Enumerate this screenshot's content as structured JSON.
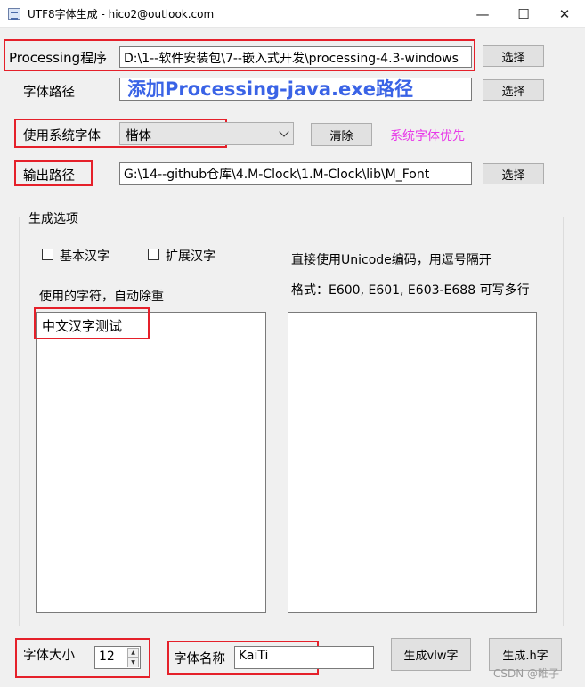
{
  "window": {
    "title": "UTF8字体生成 - hico2@outlook.com",
    "minimize_glyph": "—",
    "maximize_glyph": "☐",
    "close_glyph": "✕"
  },
  "processing": {
    "label": "Processing程序",
    "path_value": "D:\\1--软件安装包\\7--嵌入式开发\\processing-4.3-windows",
    "choose_label": "选择"
  },
  "font_path": {
    "label": "字体路径",
    "value": "",
    "choose_label": "选择"
  },
  "annotation": "添加Processing-java.exe路径",
  "system_font": {
    "label": "使用系统字体",
    "selected": "楷体",
    "clear_label": "清除",
    "priority_note": "系统字体优先"
  },
  "output_path": {
    "label": "输出路径",
    "value": "G:\\14--github仓库\\4.M-Clock\\1.M-Clock\\lib\\M_Font",
    "choose_label": "选择"
  },
  "options": {
    "group_title": "生成选项",
    "basic_hanzi_label": "基本汉字",
    "extended_hanzi_label": "扩展汉字",
    "basic_hanzi_checked": false,
    "extended_hanzi_checked": false,
    "chars_label": "使用的字符，自动除重",
    "chars_value": "中文汉字测试",
    "unicode_hint": "直接使用Unicode编码，用逗号隔开",
    "unicode_format": "格式：E600, E601, E603-E688 可写多行",
    "unicode_value": ""
  },
  "bottom": {
    "font_size_label": "字体大小",
    "font_size_value": "12",
    "font_name_label": "字体名称",
    "font_name_value": "KaiTi",
    "gen_vlw_label": "生成vlw字",
    "gen_h_label": "生成.h字"
  },
  "watermark": "CSDN @睢子",
  "colors": {
    "highlight_box": "#e5202a",
    "annotation_text": "#3a63e6",
    "priority_note": "#e838e8"
  }
}
